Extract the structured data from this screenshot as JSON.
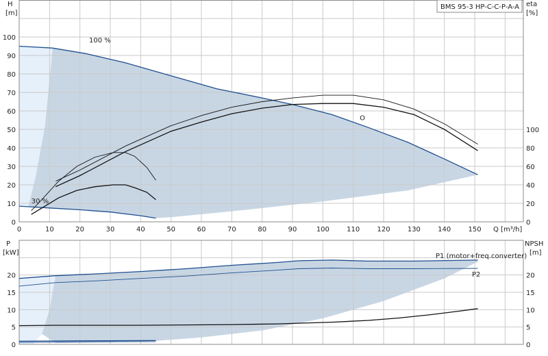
{
  "colors": {
    "envelope": "#c8d6e4",
    "light_zone": "#e6f0fa",
    "blue": "#1f4f8f",
    "black": "#111111",
    "grid": "#c9c9c9",
    "marker": "#d9281f"
  },
  "product_label": "BMS 95-3 HP-C-C-P-A-A",
  "chart_data": [
    {
      "type": "line",
      "name": "head-efficiency",
      "x_label": "Q [m³/h]",
      "x_ticks": [
        "0",
        "10",
        "20",
        "30",
        "40",
        "50",
        "60",
        "70",
        "80",
        "90",
        "100",
        "110",
        "120",
        "130",
        "140",
        "150"
      ],
      "xlim": [
        0,
        166
      ],
      "left_axis": {
        "label_top": "H",
        "label_unit": "[m]",
        "ylim": [
          0,
          120
        ],
        "ticks": [
          "0",
          "10",
          "20",
          "30",
          "40",
          "50",
          "60",
          "70",
          "80",
          "90",
          "100"
        ]
      },
      "right_axis": {
        "label_top": "eta",
        "label_unit": "[%]",
        "ylim": [
          0,
          240
        ],
        "ticks": [
          "0",
          "20",
          "40",
          "60",
          "80",
          "100"
        ]
      },
      "grid": true,
      "annotations": [
        {
          "text": "100 %",
          "x": 23,
          "y": 97
        },
        {
          "text": "30 %",
          "x": 4,
          "y": 10
        }
      ],
      "marker": {
        "symbol": "O",
        "x": 113,
        "y": 55
      },
      "series": [
        {
          "role": "head-100",
          "color": "#1f4f8f",
          "width": 1.3,
          "x": [
            0,
            11,
            22,
            35,
            50,
            65,
            80,
            90,
            103,
            115,
            128,
            140,
            151
          ],
          "y": [
            95,
            94,
            91,
            86,
            79,
            72,
            67,
            63.5,
            58,
            51,
            43,
            34,
            25.5
          ]
        },
        {
          "role": "head-30",
          "color": "#1f4f8f",
          "width": 1.3,
          "x": [
            0,
            10,
            20,
            30,
            40,
            45
          ],
          "y": [
            8.5,
            7.5,
            6.5,
            5.3,
            3.3,
            2
          ]
        },
        {
          "role": "efficiency-100",
          "color": "#111111",
          "width": 0.9,
          "x": [
            12,
            20,
            35,
            50,
            60,
            70,
            80,
            90,
            100,
            110,
            120,
            130,
            140,
            151
          ],
          "y": [
            44,
            56,
            82,
            104,
            115,
            124,
            130,
            134,
            137,
            137,
            132,
            122,
            106,
            84
          ]
        },
        {
          "role": "efficiency-100-b",
          "color": "#111111",
          "width": 1.3,
          "x": [
            12,
            20,
            35,
            50,
            60,
            70,
            80,
            90,
            100,
            110,
            120,
            130,
            140,
            151
          ],
          "y": [
            38,
            50,
            76,
            98,
            108,
            117,
            123,
            127,
            128,
            128,
            124,
            116,
            100,
            77
          ]
        },
        {
          "role": "efficiency-30",
          "color": "#111111",
          "width": 0.9,
          "x": [
            4,
            8,
            13,
            19,
            25,
            31,
            35,
            38,
            42,
            45
          ],
          "y": [
            12,
            26,
            44,
            60,
            70,
            75,
            75,
            71,
            59,
            45
          ]
        },
        {
          "role": "efficiency-30-b",
          "color": "#111111",
          "width": 1.3,
          "x": [
            4,
            8,
            13,
            19,
            25,
            31,
            35,
            38,
            42,
            45
          ],
          "y": [
            8,
            16,
            26,
            34,
            38,
            40,
            40,
            37,
            32,
            24
          ]
        }
      ]
    },
    {
      "type": "line",
      "name": "power-npsh",
      "xlim": [
        0,
        166
      ],
      "left_axis": {
        "label_top": "P",
        "label_unit": "[kW]",
        "ylim": [
          0,
          30
        ],
        "ticks": [
          "0",
          "5",
          "10",
          "15",
          "20"
        ]
      },
      "right_axis": {
        "label_top": "NPSH",
        "label_unit": "[m]",
        "ylim": [
          0,
          30
        ],
        "ticks": [
          "0",
          "5",
          "10",
          "15",
          "20"
        ]
      },
      "grid": true,
      "series": [
        {
          "name": "P1 (motor+freq.converter)",
          "color": "#1f4f8f",
          "width": 1.3,
          "x": [
            0,
            12,
            25,
            40,
            55,
            70,
            85,
            92,
            103,
            115,
            130,
            151
          ],
          "y": [
            19,
            19.8,
            20.3,
            21,
            21.8,
            22.8,
            23.6,
            24.1,
            24.3,
            24,
            24,
            24.3
          ]
        },
        {
          "name": "P2",
          "color": "#1f4f8f",
          "width": 0.9,
          "x": [
            0,
            12,
            25,
            40,
            55,
            70,
            85,
            92,
            103,
            115,
            130,
            151
          ],
          "y": [
            16.8,
            17.8,
            18.3,
            19,
            19.7,
            20.6,
            21.4,
            21.8,
            22,
            21.8,
            21.8,
            21.9
          ]
        },
        {
          "role": "npsh",
          "color": "#111111",
          "width": 1.3,
          "x": [
            0,
            12,
            25,
            40,
            55,
            70,
            85,
            92,
            103,
            115,
            125,
            135,
            145,
            151
          ],
          "y": [
            5.4,
            5.5,
            5.5,
            5.5,
            5.6,
            5.7,
            5.9,
            6.1,
            6.4,
            6.9,
            7.6,
            8.5,
            9.6,
            10.3
          ]
        },
        {
          "role": "p1-30",
          "color": "#1f4f8f",
          "width": 1.3,
          "x": [
            0,
            15,
            30,
            45
          ],
          "y": [
            0.9,
            1,
            1.05,
            1.1
          ]
        },
        {
          "role": "p2-30",
          "color": "#1f4f8f",
          "width": 0.9,
          "x": [
            0,
            15,
            30,
            45
          ],
          "y": [
            0.6,
            0.7,
            0.75,
            0.8
          ]
        }
      ]
    }
  ]
}
